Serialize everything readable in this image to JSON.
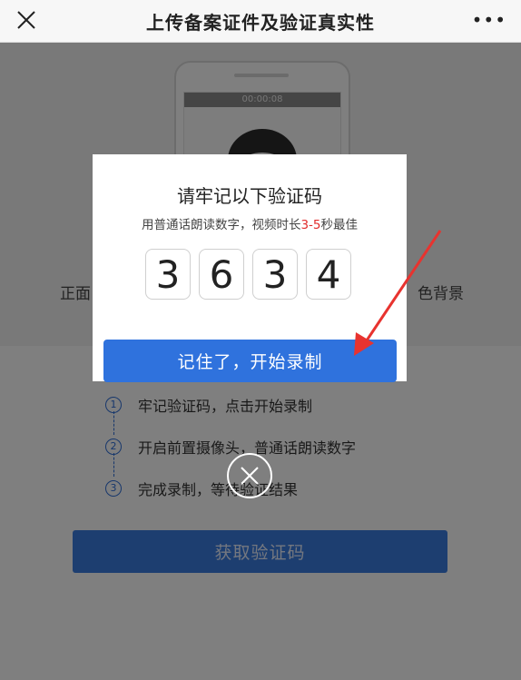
{
  "header": {
    "title": "上传备案证件及验证真实性",
    "close_icon": "close-icon",
    "more_label": "•••"
  },
  "illustration": {
    "timer": "00:00:08",
    "left_text": "正面",
    "right_text": "色背景"
  },
  "steps": [
    {
      "num": "1",
      "text": "牢记验证码，点击开始录制"
    },
    {
      "num": "2",
      "text": "开启前置摄像头，普通话朗读数字"
    },
    {
      "num": "3",
      "text": "完成录制，等待验证结果"
    }
  ],
  "get_code_label": "获取验证码",
  "modal": {
    "title": "请牢记以下验证码",
    "subtitle_prefix": "用普通话朗读数字，视频时长",
    "subtitle_highlight": "3-5",
    "subtitle_suffix": "秒最佳",
    "digits": [
      "3",
      "6",
      "3",
      "4"
    ],
    "start_label": "记住了，开始录制"
  },
  "colors": {
    "accent": "#2f72dd",
    "highlight": "#e02b2b",
    "arrow": "#e8332f"
  }
}
